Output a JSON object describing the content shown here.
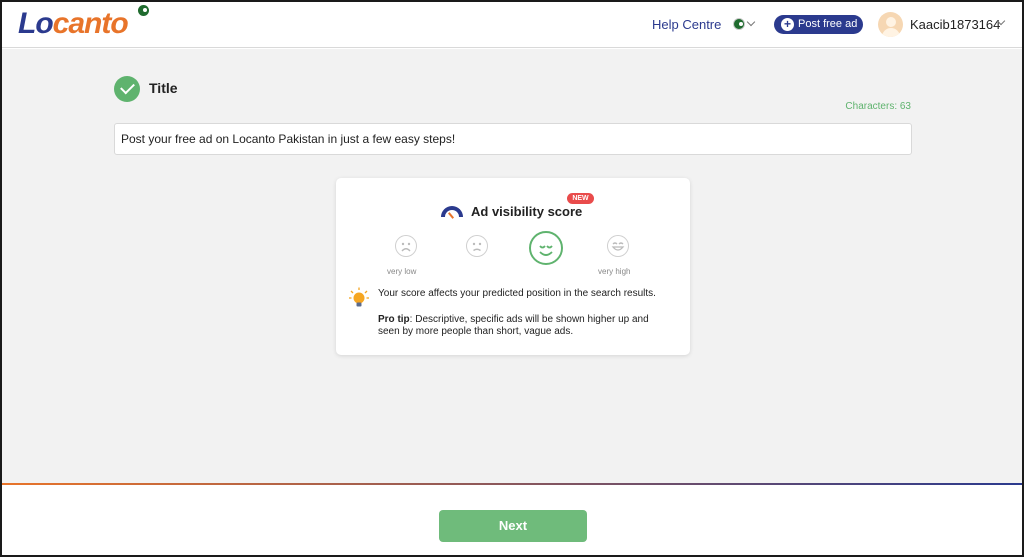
{
  "header": {
    "logo_part1": "Lo",
    "logo_part2": "canto",
    "help_label": "Help Centre",
    "country_flag_icon": "pakistan-flag-icon",
    "post_ad_label": "Post free ad",
    "username": "Kaacib1873164"
  },
  "form": {
    "section_title": "Title",
    "char_count": "Characters: 63",
    "title_value": "Post your free ad on Locanto Pakistan in just a few easy steps!"
  },
  "visibility": {
    "badge": "NEW",
    "title": "Ad visibility score",
    "scale_low": "very low",
    "scale_high": "very high",
    "selected_level": 3,
    "level_count": 4,
    "description": "Your score affects your predicted position in the search results.",
    "pro_tip_label": "Pro tip",
    "pro_tip_text": ": Descriptive, specific ads will be shown higher up and seen by more people than short, vague ads."
  },
  "footer": {
    "next_label": "Next"
  },
  "colors": {
    "brand_blue": "#2b3a8e",
    "brand_orange": "#e8742a",
    "success_green": "#5fb36e",
    "new_badge_red": "#e94b4b"
  }
}
